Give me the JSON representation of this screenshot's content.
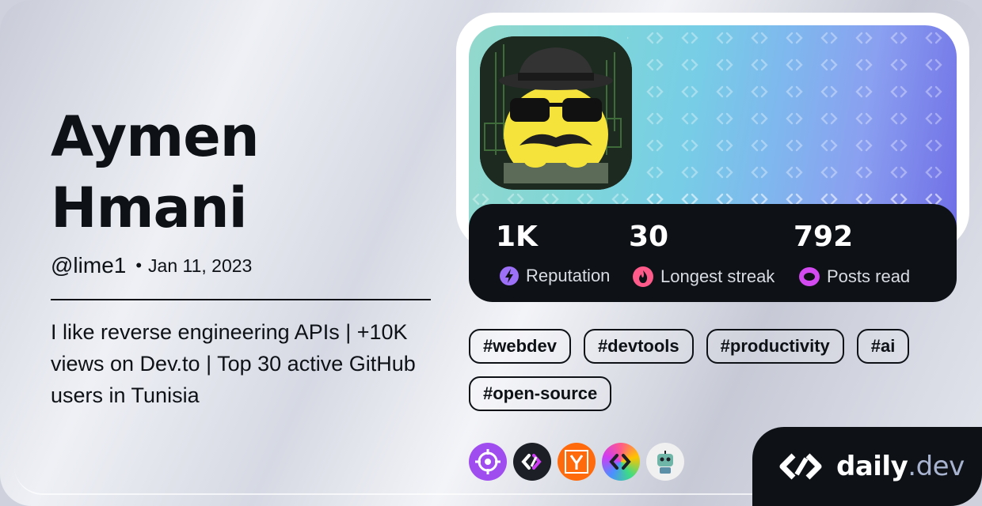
{
  "profile": {
    "first_name": "Aymen",
    "last_name": "Hmani",
    "handle": "@lime1",
    "separator": "•",
    "joined": "Jan 11, 2023",
    "bio": "I like reverse engineering APIs | +10K views on Dev.to | Top 30 active GitHub users in Tunisia"
  },
  "stats": [
    {
      "value": "1K",
      "label": "Reputation",
      "icon": "lightning-icon",
      "color": "#9d70f8"
    },
    {
      "value": "30",
      "label": "Longest streak",
      "icon": "flame-icon",
      "color": "#ff5a8a"
    },
    {
      "value": "792",
      "label": "Posts read",
      "icon": "eye-ring-icon",
      "color": "#d24af0"
    }
  ],
  "tags": [
    "#webdev",
    "#devtools",
    "#productivity",
    "#ai",
    "#open-source"
  ],
  "sources": [
    {
      "icon": "crosshair-icon",
      "color": "#a04df0"
    },
    {
      "icon": "daily-dev-logo-icon",
      "color": "#1c1f26"
    },
    {
      "icon": "hacker-news-icon",
      "color": "#ff6a0c"
    },
    {
      "icon": "rainbow-dev-icon",
      "color": "#ff5a8a"
    },
    {
      "icon": "robot-icon",
      "color": "#f0f0f0"
    }
  ],
  "brand": {
    "name": "daily",
    "tld": ".dev"
  }
}
